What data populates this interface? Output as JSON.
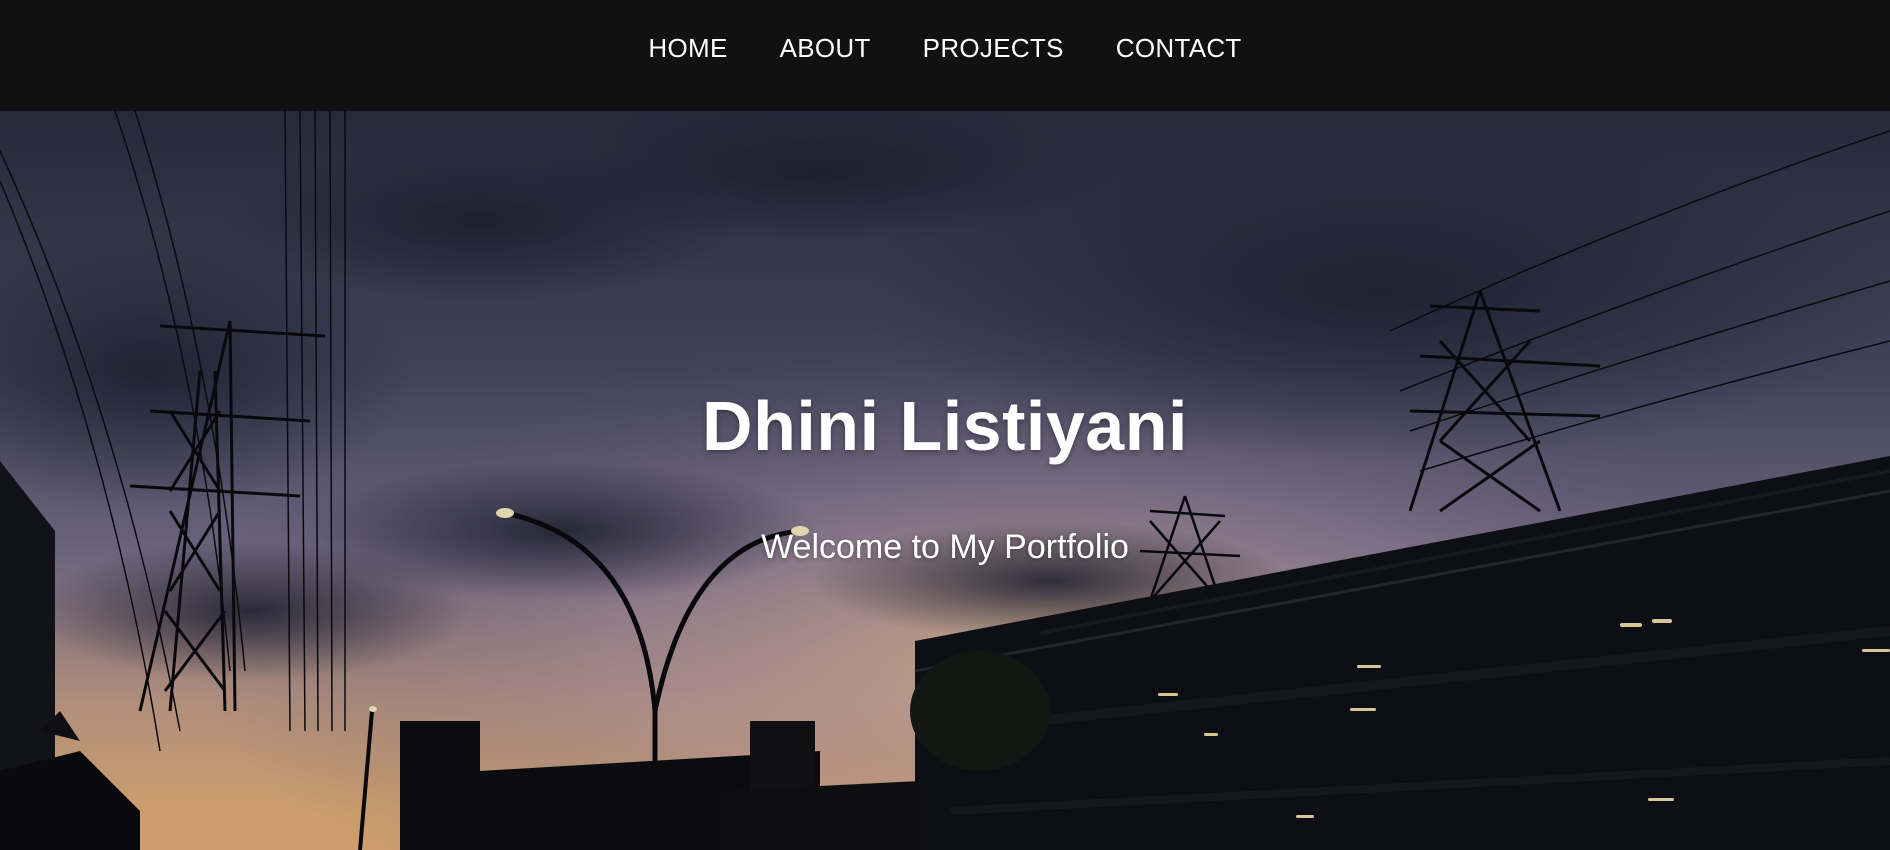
{
  "nav": {
    "items": [
      {
        "label": "HOME"
      },
      {
        "label": "ABOUT"
      },
      {
        "label": "PROJECTS"
      },
      {
        "label": "CONTACT"
      }
    ]
  },
  "hero": {
    "title": "Dhini Listiyani",
    "subtitle": "Welcome to My Portfolio",
    "background": "dusk-city-power-lines-photo"
  },
  "colors": {
    "nav_background": "#111111",
    "text": "#ffffff",
    "sky_top": "#3a3f55",
    "sky_glow": "#e8b98a"
  }
}
